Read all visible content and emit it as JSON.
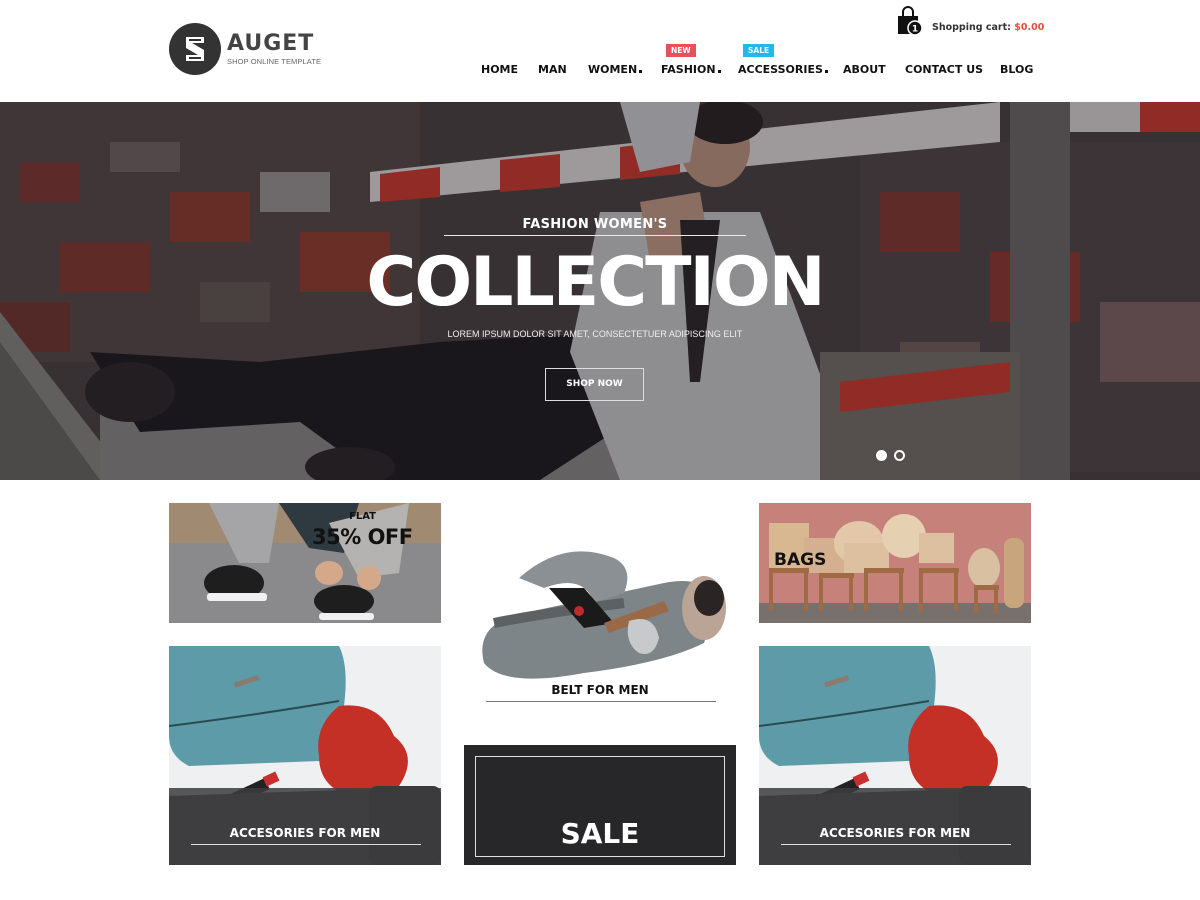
{
  "header": {
    "logo": {
      "name": "AUGET",
      "tagline": "SHOP ONLINE TEMPLATE",
      "letter": "S"
    },
    "cart": {
      "icon": "shopping-bag-icon",
      "count": "1",
      "label": "Shopping cart:",
      "amount": "$0.00",
      "amount_color": "#e74c3c"
    },
    "nav": [
      {
        "label": "HOME",
        "dropdown": false
      },
      {
        "label": "MAN",
        "dropdown": false
      },
      {
        "label": "WOMEN",
        "dropdown": true
      },
      {
        "label": "FASHION",
        "dropdown": true,
        "badge": "NEW",
        "badge_color": "#e5525a"
      },
      {
        "label": "ACCESSORIES",
        "dropdown": true,
        "badge": "SALE",
        "badge_color": "#1fb8ef"
      },
      {
        "label": "ABOUT",
        "dropdown": false
      },
      {
        "label": "CONTACT US",
        "dropdown": false
      },
      {
        "label": "BLOG",
        "dropdown": false
      }
    ]
  },
  "hero": {
    "subtitle": "FASHION WOMEN'S",
    "title": "COLLECTION",
    "description": "LOREM IPSUM DOLOR SIT AMET, CONSECTETUER ADIPISCING ELIT",
    "button_label": "SHOP NOW",
    "slides": {
      "total": 2,
      "active": 1
    }
  },
  "banners": {
    "shoes": {
      "small": "FLAT",
      "big": "35% OFF"
    },
    "belt": {
      "label": "BELT FOR MEN"
    },
    "bags": {
      "label": "BAGS"
    },
    "accessories_left": {
      "label": "ACCESORIES FOR MEN"
    },
    "sale": {
      "label": "SALE"
    },
    "accessories_right": {
      "label": "ACCESORIES FOR MEN"
    }
  }
}
